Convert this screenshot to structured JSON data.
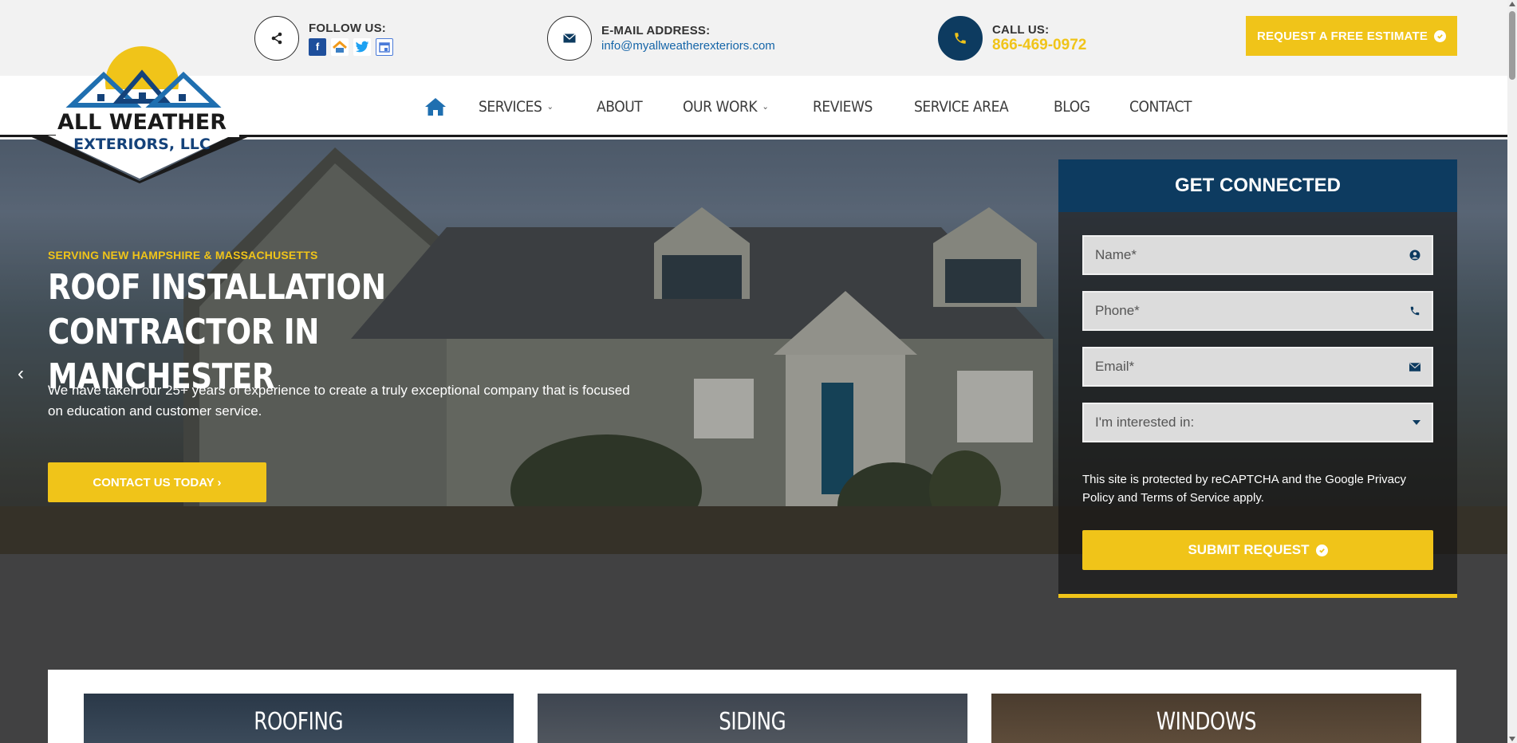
{
  "topbar": {
    "follow_label": "FOLLOW US:",
    "social_icons": [
      "facebook-icon",
      "homeadvisor-icon",
      "twitter-icon",
      "google-business-icon"
    ],
    "email_label": "E-MAIL ADDRESS:",
    "email_value": "info@myallweatherexteriors.com",
    "call_label": "CALL US:",
    "phone_value": "866-469-0972",
    "estimate_label": "REQUEST A FREE ESTIMATE"
  },
  "logo": {
    "line1": "ALL WEATHER",
    "line2": "EXTERIORS, LLC"
  },
  "nav": {
    "items": [
      "SERVICES",
      "ABOUT",
      "OUR WORK",
      "REVIEWS",
      "SERVICE AREA",
      "BLOG",
      "CONTACT"
    ]
  },
  "hero": {
    "tagline": "SERVING NEW HAMPSHIRE & MASSACHUSETTS",
    "title": "ROOF INSTALLATION CONTRACTOR IN MANCHESTER",
    "description": "We have taken our 25+ years of experience to create a truly exceptional company that is focused on education and customer service.",
    "cta_label": "CONTACT US TODAY ›"
  },
  "form": {
    "heading": "GET CONNECTED",
    "name_placeholder": "Name*",
    "phone_placeholder": "Phone*",
    "email_placeholder": "Email*",
    "interest_placeholder": "I'm interested in:",
    "recaptcha_note": "This site is protected by reCAPTCHA and the Google Privacy Policy and Terms of Service apply.",
    "submit_label": "SUBMIT REQUEST"
  },
  "services": {
    "cards": [
      "ROOFING",
      "SIDING",
      "WINDOWS"
    ]
  },
  "colors": {
    "accent_yellow": "#f0c419",
    "navy": "#0d3b60",
    "link_blue": "#1565a8"
  }
}
